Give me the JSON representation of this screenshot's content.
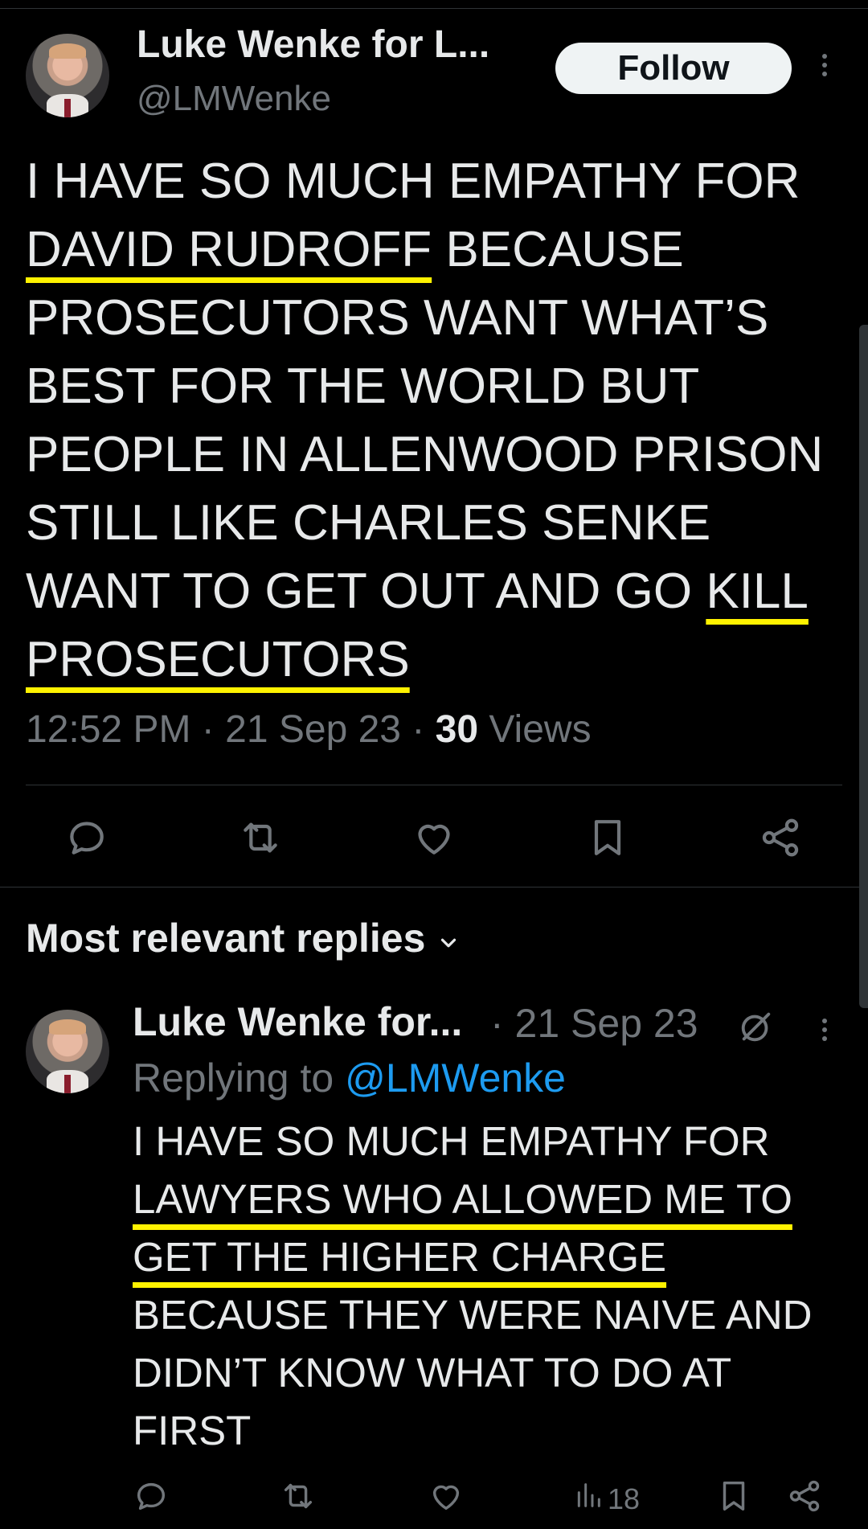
{
  "tweet": {
    "author_name": "Luke Wenke for L...",
    "handle": "@LMWenke",
    "follow_label": "Follow",
    "text": [
      {
        "t": "I HAVE SO MUCH EMPATHY FOR "
      },
      {
        "t": "DAVID RUDROFF",
        "hl": true
      },
      {
        "t": " BECAUSE PROSECUTORS WANT WHAT’S BEST FOR THE WORLD BUT PEOPLE IN ALLENWOOD PRISON STILL LIKE CHARLES SENKE WANT TO GET OUT AND GO "
      },
      {
        "t": "KILL PROSECUTORS",
        "hl": true
      }
    ],
    "time": "12:52 PM",
    "date": "21 Sep 23",
    "views_count": "30",
    "views_label": "Views",
    "actions": [
      "reply-icon",
      "retweet-icon",
      "like-icon",
      "bookmark-icon",
      "share-icon"
    ]
  },
  "replies_header": "Most relevant replies",
  "reply": {
    "author_name": "Luke Wenke for...",
    "date": "· 21 Sep 23",
    "replying_to_label": "Replying to",
    "replying_to_handle": "@LMWenke",
    "text": [
      {
        "t": "I HAVE SO MUCH EMPATHY FOR "
      },
      {
        "t": "LAWYERS WHO ALLOWED ME TO GET THE HIGHER CHARGE",
        "hl": true
      },
      {
        "t": " BECAUSE THEY WERE NAIVE AND DIDN’T KNOW WHAT TO DO AT FIRST"
      }
    ],
    "views_count": "18",
    "actions": [
      "reply-icon",
      "retweet-icon",
      "like-icon",
      "views-icon",
      "bookmark-icon",
      "share-icon"
    ]
  },
  "colors": {
    "background": "#000000",
    "text": "#e7e9ea",
    "secondary": "#71767b",
    "link": "#1d9bf0",
    "highlight_underline": "#fff200"
  }
}
